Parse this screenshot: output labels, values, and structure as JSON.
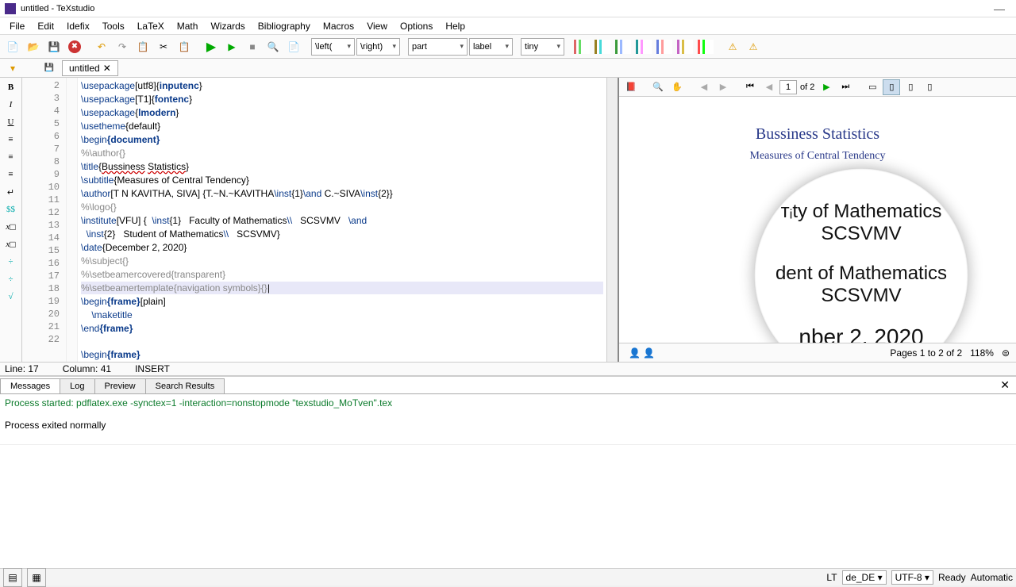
{
  "window": {
    "title": "untitled - TeXstudio"
  },
  "menu": [
    "File",
    "Edit",
    "Idefix",
    "Tools",
    "LaTeX",
    "Math",
    "Wizards",
    "Bibliography",
    "Macros",
    "View",
    "Options",
    "Help"
  ],
  "toolbar": {
    "left_delim": "\\left(",
    "right_delim": "\\right)",
    "section": "part",
    "label": "label",
    "size": "tiny"
  },
  "doctab": {
    "name": "untitled"
  },
  "editor": {
    "first_line": 2,
    "lines": [
      {
        "n": 2,
        "raw": "\\usepackage[utf8]{inputenc}",
        "fmt": [
          [
            "kw",
            "\\usepackage"
          ],
          [
            "str",
            "[utf8]{"
          ],
          [
            "arg",
            "inputenc"
          ],
          [
            "str",
            "}"
          ]
        ]
      },
      {
        "n": 3,
        "raw": "\\usepackage[T1]{fontenc}",
        "fmt": [
          [
            "kw",
            "\\usepackage"
          ],
          [
            "str",
            "[T1]{"
          ],
          [
            "arg",
            "fontenc"
          ],
          [
            "str",
            "}"
          ]
        ]
      },
      {
        "n": 4,
        "raw": "\\usepackage{lmodern}",
        "fmt": [
          [
            "kw",
            "\\usepackage"
          ],
          [
            "str",
            "{"
          ],
          [
            "arg",
            "lmodern"
          ],
          [
            "str",
            "}"
          ]
        ]
      },
      {
        "n": 5,
        "raw": "\\usetheme{default}",
        "fmt": [
          [
            "kw",
            "\\usetheme"
          ],
          [
            "str",
            "{default}"
          ]
        ]
      },
      {
        "n": 6,
        "raw": "\\begin{document}",
        "fmt": [
          [
            "kw",
            "\\begin"
          ],
          [
            "arg",
            "{document}"
          ]
        ]
      },
      {
        "n": 7,
        "raw": "%\\author{}",
        "fmt": [
          [
            "cmt",
            "%\\author{}"
          ]
        ]
      },
      {
        "n": 8,
        "raw": "\\title{Bussiness Statistics}",
        "fmt": [
          [
            "kw",
            "\\title"
          ],
          [
            "str",
            "{"
          ],
          [
            "wavy",
            "Bussiness"
          ],
          [
            "str",
            " "
          ],
          [
            "wavy",
            "Statistics"
          ],
          [
            "str",
            "}"
          ]
        ]
      },
      {
        "n": 9,
        "raw": "\\subtitle{Measures of Central Tendency}",
        "fmt": [
          [
            "kw",
            "\\subtitle"
          ],
          [
            "str",
            "{Measures of Central Tendency}"
          ]
        ]
      },
      {
        "n": 10,
        "raw": "\\author[T N KAVITHA, SIVA] {T.~N.~KAVITHA\\inst{1}\\and C.~SIVA\\inst{2}}",
        "fmt": [
          [
            "kw",
            "\\author"
          ],
          [
            "str",
            "[T N KAVITHA, SIVA] {T.~N.~KAVITHA"
          ],
          [
            "kw",
            "\\inst"
          ],
          [
            "str",
            "{1}"
          ],
          [
            "kw",
            "\\and"
          ],
          [
            "str",
            " C.~SIVA"
          ],
          [
            "kw",
            "\\inst"
          ],
          [
            "str",
            "{2}}"
          ]
        ]
      },
      {
        "n": 11,
        "raw": "%\\logo{}",
        "fmt": [
          [
            "cmt",
            "%\\logo{}"
          ]
        ]
      },
      {
        "n": 12,
        "raw": "\\institute[VFU] {  \\inst{1}   Faculty of Mathematics\\\\   SCSVMV   \\and",
        "fmt": [
          [
            "kw",
            "\\institute"
          ],
          [
            "str",
            "[VFU] {  "
          ],
          [
            "kw",
            "\\inst"
          ],
          [
            "str",
            "{1}   Faculty of Mathematics"
          ],
          [
            "kw",
            "\\\\"
          ],
          [
            "str",
            "   SCSVMV   "
          ],
          [
            "kw",
            "\\and"
          ]
        ]
      },
      {
        "n": 13,
        "raw": "  \\inst{2}   Student of Mathematics\\\\   SCSVMV}",
        "fmt": [
          [
            "str",
            "  "
          ],
          [
            "kw",
            "\\inst"
          ],
          [
            "str",
            "{2}   Student of Mathematics"
          ],
          [
            "kw",
            "\\\\"
          ],
          [
            "str",
            "   SCSVMV}"
          ]
        ]
      },
      {
        "n": 14,
        "raw": "\\date{December 2, 2020}",
        "fmt": [
          [
            "kw",
            "\\date"
          ],
          [
            "str",
            "{December 2, 2020}"
          ]
        ]
      },
      {
        "n": 15,
        "raw": "%\\subject{}",
        "fmt": [
          [
            "cmt",
            "%\\subject{}"
          ]
        ]
      },
      {
        "n": 16,
        "raw": "%\\setbeamercovered{transparent}",
        "fmt": [
          [
            "cmt",
            "%\\setbeamercovered{transparent}"
          ]
        ]
      },
      {
        "n": 17,
        "hl": true,
        "raw": "%\\setbeamertemplate{navigation symbols}{}",
        "fmt": [
          [
            "cmt",
            "%\\setbeamertemplate{navigation symbols}{}"
          ]
        ]
      },
      {
        "n": 18,
        "raw": "\\begin{frame}[plain]",
        "fmt": [
          [
            "kw",
            "\\begin"
          ],
          [
            "arg",
            "{frame}"
          ],
          [
            "str",
            "[plain]"
          ]
        ]
      },
      {
        "n": 19,
        "raw": "    \\maketitle",
        "fmt": [
          [
            "str",
            "    "
          ],
          [
            "kw",
            "\\maketitle"
          ]
        ]
      },
      {
        "n": 20,
        "raw": "\\end{frame}",
        "fmt": [
          [
            "kw",
            "\\end"
          ],
          [
            "arg",
            "{frame}"
          ]
        ]
      },
      {
        "n": 21,
        "raw": "",
        "fmt": []
      },
      {
        "n": 22,
        "raw": "\\begin{frame}",
        "fmt": [
          [
            "kw",
            "\\begin"
          ],
          [
            "arg",
            "{frame}"
          ]
        ]
      }
    ]
  },
  "status": {
    "line": "Line: 17",
    "col": "Column: 41",
    "mode": "INSERT"
  },
  "bottom": {
    "tabs": [
      "Messages",
      "Log",
      "Preview",
      "Search Results"
    ],
    "active": 0,
    "msg1": "Process started: pdflatex.exe -synctex=1 -interaction=nonstopmode \"texstudio_MoTven\".tex",
    "msg2": "Process exited normally"
  },
  "preview": {
    "page_current": "1",
    "page_total": "of 2",
    "title": "Bussiness Statistics",
    "subtitle": "Measures of Central Tendency",
    "mag": {
      "l1": "ᴛᵢty of Mathematics",
      "l2": "SCSVMV",
      "l3": "dent of Mathematics",
      "l4": "SCSVMV",
      "l5": "nber 2, 2020"
    },
    "footer_pages": "Pages 1 to 2 of 2",
    "footer_zoom": "118%"
  },
  "appstatus": {
    "lt": "LT",
    "lang": "de_DE",
    "enc": "UTF-8",
    "ready": "Ready",
    "auto": "Automatic"
  }
}
